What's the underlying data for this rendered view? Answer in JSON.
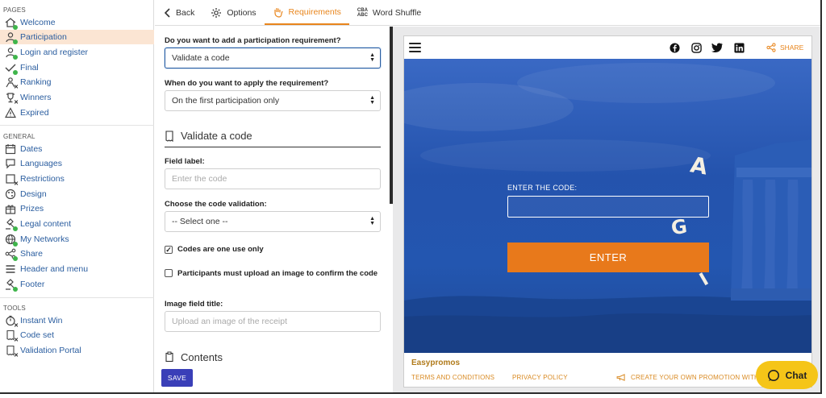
{
  "sidebar": {
    "pages_title": "PAGES",
    "general_title": "GENERAL",
    "tools_title": "TOOLS",
    "pages": [
      {
        "label": "Welcome",
        "icon": "home-icon"
      },
      {
        "label": "Participation",
        "icon": "user-icon",
        "active": true
      },
      {
        "label": "Login and register",
        "icon": "user-login-icon"
      },
      {
        "label": "Final",
        "icon": "checkmark-icon"
      },
      {
        "label": "Ranking",
        "icon": "ranking-icon"
      },
      {
        "label": "Winners",
        "icon": "trophy-icon"
      },
      {
        "label": "Expired",
        "icon": "warning-icon"
      }
    ],
    "general": [
      {
        "label": "Dates",
        "icon": "calendar-icon"
      },
      {
        "label": "Languages",
        "icon": "speech-bubble-icon"
      },
      {
        "label": "Restrictions",
        "icon": "restriction-icon"
      },
      {
        "label": "Design",
        "icon": "palette-icon"
      },
      {
        "label": "Prizes",
        "icon": "gift-icon"
      },
      {
        "label": "Legal content",
        "icon": "gavel-icon"
      },
      {
        "label": "My Networks",
        "icon": "globe-icon"
      },
      {
        "label": "Share",
        "icon": "share-icon"
      },
      {
        "label": "Header and menu",
        "icon": "menu-icon"
      },
      {
        "label": "Footer",
        "icon": "footer-icon"
      }
    ],
    "tools": [
      {
        "label": "Instant Win",
        "icon": "instant-win-icon"
      },
      {
        "label": "Code set",
        "icon": "code-set-icon"
      },
      {
        "label": "Validation Portal",
        "icon": "validation-portal-icon"
      }
    ]
  },
  "tabs": {
    "back": "Back",
    "options": "Options",
    "requirements": "Requirements",
    "word_shuffle": "Word Shuffle",
    "word_shuffle_icon_top": "CBA",
    "word_shuffle_icon_bottom": "ABC"
  },
  "form": {
    "q1_label": "Do you want to add a participation requirement?",
    "q1_value": "Validate a code",
    "q2_label": "When do you want to apply the requirement?",
    "q2_value": "On the first participation only",
    "section_title": "Validate a code",
    "field_label_title": "Field label:",
    "field_label_placeholder": "Enter the code",
    "validation_title": "Choose the code validation:",
    "validation_value": "-- Select one --",
    "check1_label": "Codes are one use only",
    "check1_checked": true,
    "check2_label": "Participants must upload an image to confirm the code",
    "check2_checked": false,
    "image_title_label": "Image field title:",
    "image_title_placeholder": "Upload an image of the receipt",
    "contents_title": "Contents",
    "save_label": "SAVE"
  },
  "preview": {
    "share_label": "SHARE",
    "enter_code_label": "ENTER THE CODE:",
    "enter_button": "ENTER",
    "shuffle_letters": [
      "A",
      "G",
      "I"
    ],
    "brand": "Easypromos",
    "terms_link": "TERMS AND CONDITIONS",
    "privacy_link": "PRIVACY POLICY",
    "create_link": "CREATE YOUR OWN PROMOTION WITH"
  },
  "chat": {
    "label": "Chat"
  },
  "colors": {
    "accent": "#e8851c",
    "link": "#2a5d9f",
    "active_bg": "#fbe5d3",
    "save": "#3a3fb8",
    "preview_blue": "#1e4fa3",
    "enter_button": "#e8791b",
    "chat": "#f5c518",
    "status_dot": "#3fb54b"
  }
}
